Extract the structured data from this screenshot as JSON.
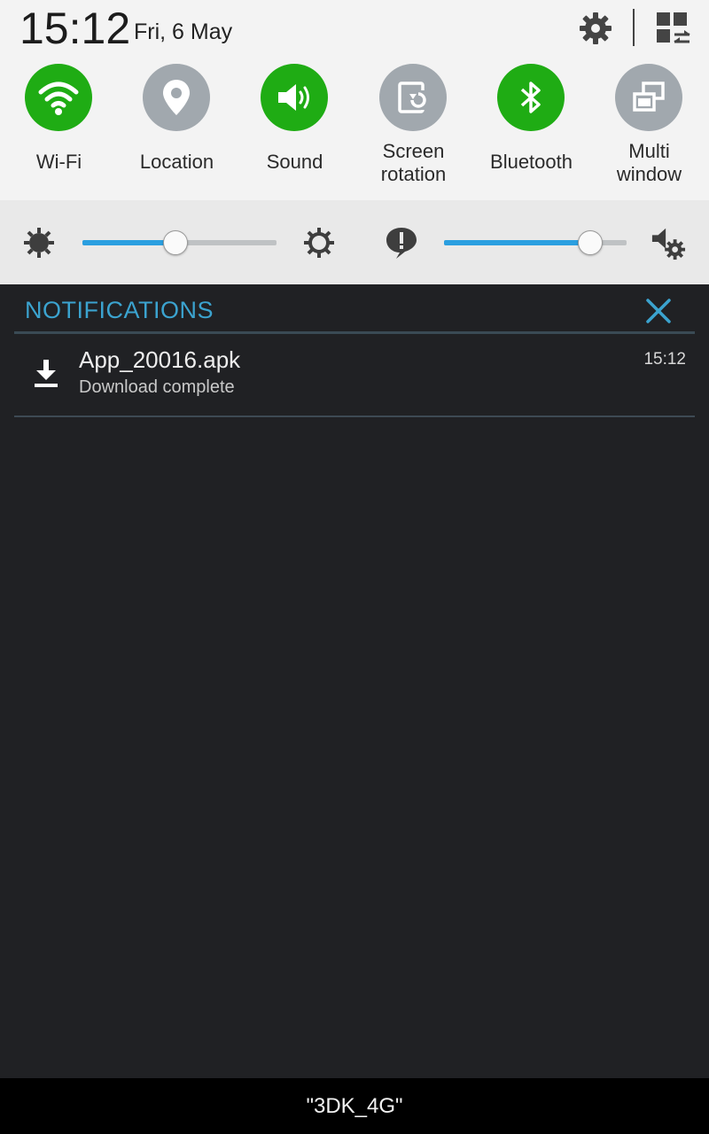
{
  "header": {
    "time": "15:12",
    "date": "Fri, 6 May",
    "settings_icon": "gear-icon",
    "edit_icon": "grid-edit-icon"
  },
  "toggles": [
    {
      "label": "Wi-Fi",
      "icon": "wifi-icon",
      "state": "on"
    },
    {
      "label": "Location",
      "icon": "location-pin-icon",
      "state": "off"
    },
    {
      "label": "Sound",
      "icon": "speaker-icon",
      "state": "on"
    },
    {
      "label_line1": "Screen",
      "label_line2": "rotation",
      "icon": "rotation-icon",
      "state": "off"
    },
    {
      "label": "Bluetooth",
      "icon": "bluetooth-icon",
      "state": "on"
    },
    {
      "label_line1": "Multi",
      "label_line2": "window",
      "icon": "multi-window-icon",
      "state": "off"
    }
  ],
  "sliders": {
    "brightness": {
      "value": 0.48
    },
    "notification_volume": {
      "value": 0.8
    }
  },
  "notifications": {
    "header": "NOTIFICATIONS",
    "items": [
      {
        "title": "App_20016.apk",
        "subtitle": "Download complete",
        "time": "15:12",
        "icon": "download-icon"
      }
    ]
  },
  "carrier": "\"3DK_4G\"",
  "colors": {
    "toggle_on": "#1fac14",
    "toggle_off": "#a1a8ae",
    "accent": "#2b9fe0",
    "notif_header": "#3ba3cf",
    "panel_bg": "#202124"
  }
}
